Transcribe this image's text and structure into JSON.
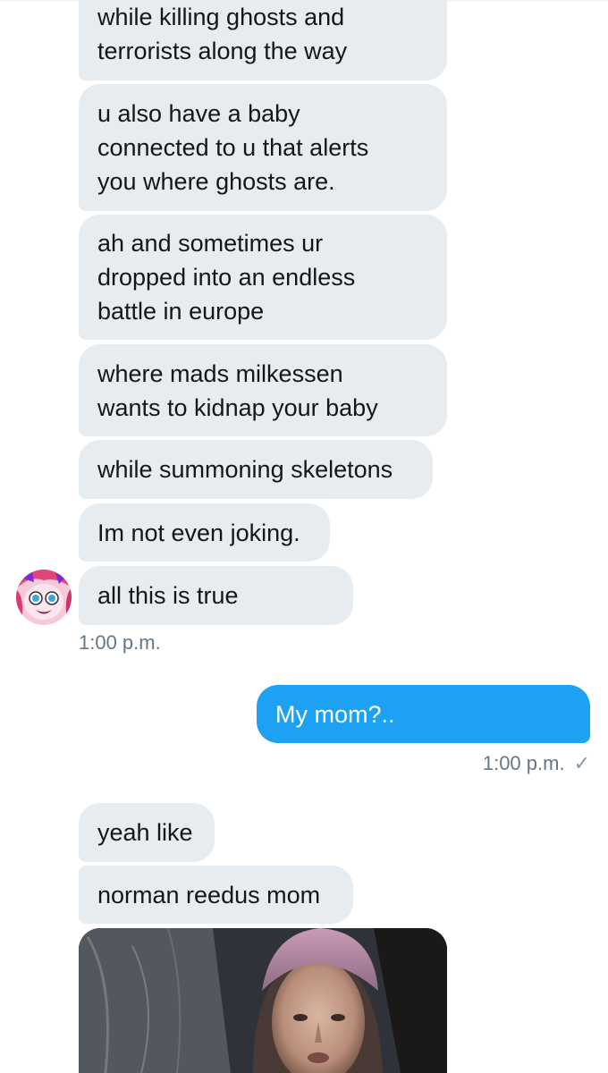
{
  "conversation": {
    "received_group_1": [
      "while killing ghosts and\nterrorists along the way",
      "u also have a baby\nconnected to u that alerts\nyou where ghosts are.",
      "ah and sometimes ur\ndropped into an endless\nbattle in europe",
      "where mads milkessen\nwants to kidnap your baby",
      "while summoning skeletons",
      "Im not even joking.",
      "all this is true"
    ],
    "received_group_1_time": "1:00 p.m.",
    "sent_message": "My mom?..",
    "sent_time": "1:00 p.m.",
    "sent_status_icon": "checkmark-icon",
    "received_group_2": [
      "yeah like",
      "norman reedus mom"
    ],
    "attachment": {
      "type": "image",
      "description_icon": "photo-attachment"
    }
  },
  "colors": {
    "received_bubble": "#e6ecf0",
    "sent_bubble": "#1da1f2",
    "timestamp": "#657786",
    "text": "#14171a"
  }
}
